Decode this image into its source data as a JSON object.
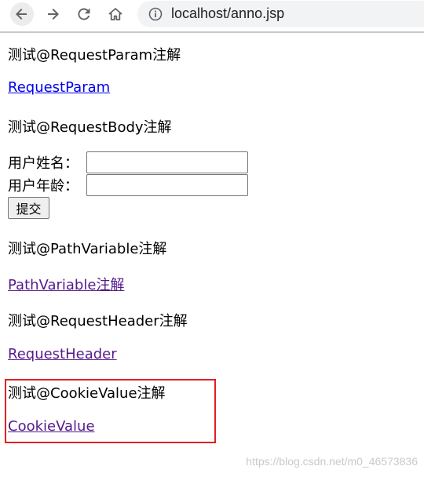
{
  "browser": {
    "url": "localhost/anno.jsp"
  },
  "page": {
    "sections": [
      {
        "heading": "测试@RequestParam注解",
        "link": "RequestParam"
      },
      {
        "heading": "测试@RequestBody注解"
      },
      {
        "heading": "测试@PathVariable注解",
        "link": "PathVariable注解"
      },
      {
        "heading": "测试@RequestHeader注解",
        "link": "RequestHeader"
      },
      {
        "heading": "测试@CookieValue注解",
        "link": "CookieValue"
      }
    ],
    "form": {
      "username_label": "用户姓名：",
      "username_value": "",
      "age_label": "用户年龄：",
      "age_value": "",
      "submit_label": "提交"
    }
  },
  "watermark": "https://blog.csdn.net/m0_46573836",
  "colors": {
    "link_unvisited": "#0000ee",
    "link_visited": "#551a8b",
    "highlight_border": "#e02020"
  },
  "icons": [
    "back-arrow-icon",
    "forward-arrow-icon",
    "reload-icon",
    "home-icon",
    "info-icon"
  ]
}
